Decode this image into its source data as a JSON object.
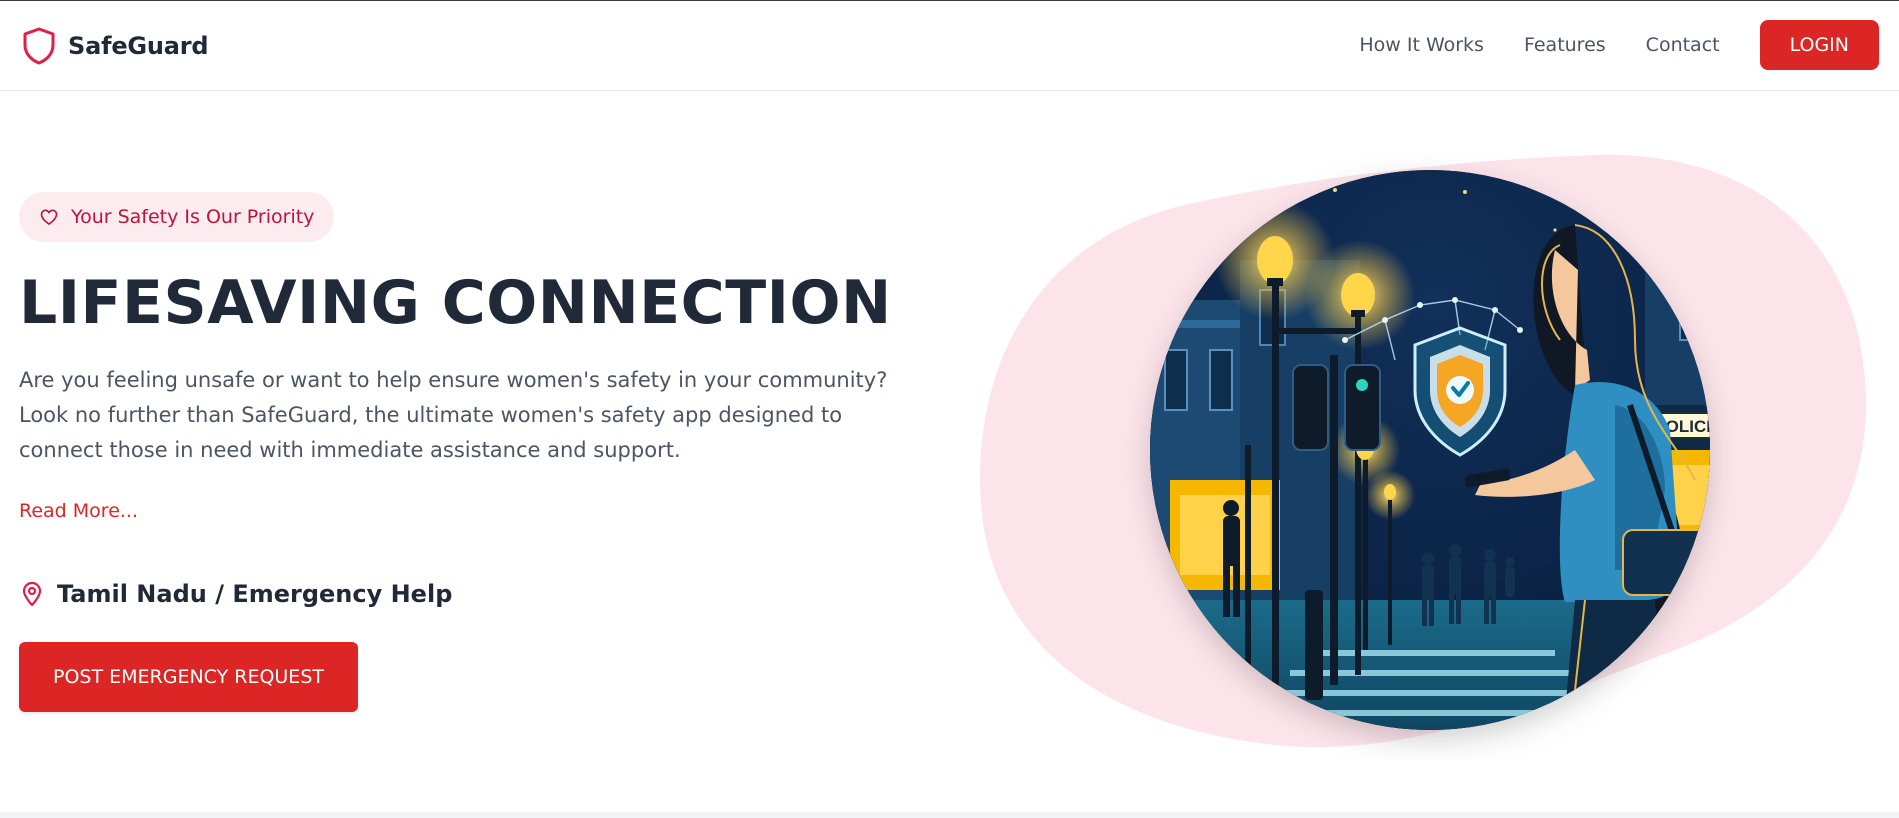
{
  "app": {
    "brand_name": "SafeGuard",
    "accent_color": "#dc2626",
    "brand_icon": "shield-icon"
  },
  "nav": {
    "links": [
      {
        "label": "How It Works"
      },
      {
        "label": "Features"
      },
      {
        "label": "Contact"
      }
    ],
    "login_label": "LOGIN"
  },
  "hero": {
    "badge_icon": "heart-icon",
    "badge": "Your Safety Is Our Priority",
    "title": "LIFESAVING CONNECTION",
    "description": "Are you feeling unsafe or want to help ensure women's safety in your community? Look no further than SafeGuard, the ultimate women's safety app designed to connect those in need with immediate assistance and support.",
    "read_more": "Read More...",
    "location_icon": "map-pin-icon",
    "location": "Tamil Nadu / Emergency Help",
    "cta": "POST EMERGENCY REQUEST",
    "illustration": {
      "sign_text": "POLICE"
    }
  }
}
